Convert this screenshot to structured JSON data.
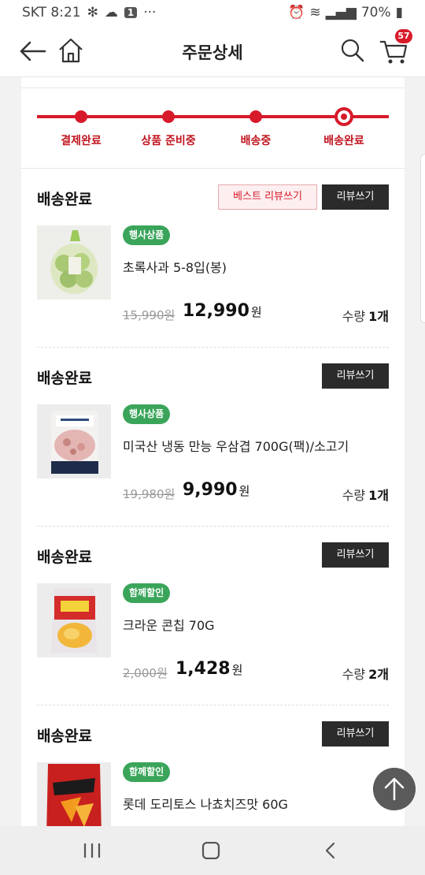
{
  "status_bar": {
    "carrier_time": "SKT 8:21",
    "notif_count": "1",
    "more": "···",
    "battery": "70%"
  },
  "header": {
    "title": "주문상세",
    "cart_count": "57"
  },
  "progress": {
    "steps": [
      "결제완료",
      "상품 준비중",
      "배송중",
      "배송완료"
    ],
    "current_step": 4
  },
  "buttons": {
    "best_review": "베스트 리뷰쓰기",
    "review": "리뷰쓰기"
  },
  "items": [
    {
      "status": "배송완료",
      "tag": "행사상품",
      "tag_color": "#3aa55a",
      "name": "초록사과 5-8입(봉)",
      "old_price": "15,990원",
      "price": "12,990",
      "won": "원",
      "qty_label": "수량",
      "qty": "1개"
    },
    {
      "status": "배송완료",
      "tag": "행사상품",
      "tag_color": "#3aa55a",
      "name": "미국산 냉동 만능 우삼겹 700G(팩)/소고기",
      "old_price": "19,980원",
      "price": "9,990",
      "won": "원",
      "qty_label": "수량",
      "qty": "1개"
    },
    {
      "status": "배송완료",
      "tag": "함께할인",
      "tag_color": "#3aa55a",
      "name": "크라운 콘칩 70G",
      "old_price": "2,000원",
      "price": "1,428",
      "won": "원",
      "qty_label": "수량",
      "qty": "2개"
    },
    {
      "status": "배송완료",
      "tag": "함께할인",
      "tag_color": "#3aa55a",
      "name": "롯데 도리토스 나쵸치즈맛 60G"
    }
  ],
  "colors": {
    "accent": "#d71a2a",
    "tag_green": "#3aa55a",
    "dark_button": "#2b2b2b"
  }
}
